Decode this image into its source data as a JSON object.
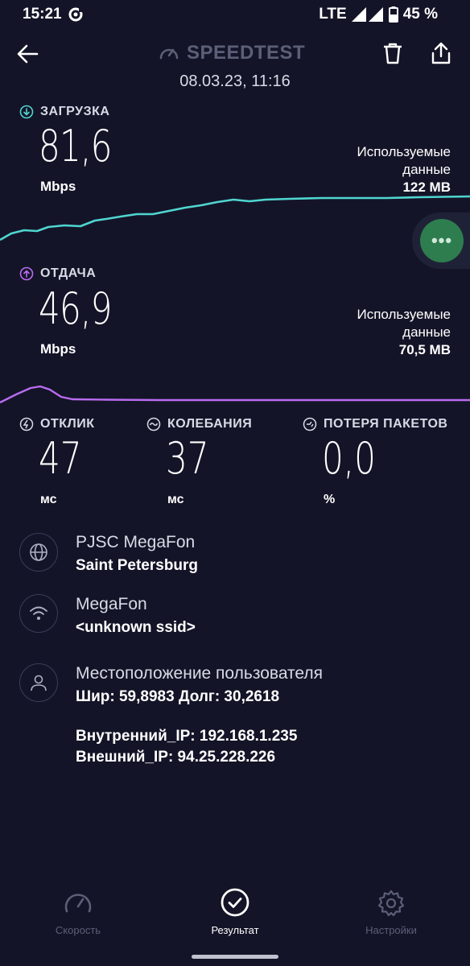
{
  "status_bar": {
    "time": "15:21",
    "network": "LTE",
    "battery": "45 %"
  },
  "header": {
    "brand": "SPEEDTEST",
    "datetime": "08.03.23, 11:16"
  },
  "download": {
    "label": "ЗАГРУЗКА",
    "value": "81,6",
    "unit": "Mbps",
    "used_label_1": "Используемые",
    "used_label_2": "данные",
    "used_value": "122 MB",
    "color": "#4fd6d0"
  },
  "upload": {
    "label": "ОТДАЧА",
    "value": "46,9",
    "unit": "Mbps",
    "used_label_1": "Используемые",
    "used_label_2": "данные",
    "used_value": "70,5 MB",
    "color": "#b96cf0"
  },
  "stats": {
    "ping": {
      "label": "ОТКЛИК",
      "value": "47",
      "unit": "мс"
    },
    "jitter": {
      "label": "КОЛЕБАНИЯ",
      "value": "37",
      "unit": "мс"
    },
    "loss": {
      "label": "ПОТЕРЯ ПАКЕТОВ",
      "value": "0,0",
      "unit": "%"
    }
  },
  "info": {
    "provider": {
      "line1": "PJSC MegaFon",
      "line2": "Saint Petersburg"
    },
    "network": {
      "line1": "MegaFon",
      "line2": "<unknown ssid>"
    },
    "location": {
      "line1": "Местоположение пользователя",
      "line2": "Шир: 59,8983 Долг: 30,2618"
    },
    "internal_ip": "Внутренний_IP: 192.168.1.235",
    "external_ip": "Внешний_IP: 94.25.228.226"
  },
  "fab": {
    "label": "•••"
  },
  "nav": {
    "speed": "Скорость",
    "result": "Результат",
    "settings": "Настройки"
  }
}
